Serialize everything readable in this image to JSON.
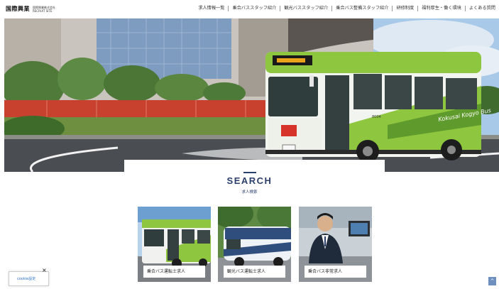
{
  "header": {
    "logo_mark": "国際興業",
    "logo_line1": "国際興業株式会社",
    "logo_line2": "RECRUIT SITE"
  },
  "nav": [
    "求人情報一覧",
    "乗合バススタッフ紹介",
    "観光バススタッフ紹介",
    "乗合バス整備スタッフ紹介",
    "研修制度",
    "福利厚生・働く環境",
    "よくある質問"
  ],
  "hero": {
    "bus_sign": "Kokusai Kogyo Bus",
    "bus_number": "8004"
  },
  "search": {
    "title": "SEARCH",
    "subtitle": "求人検索"
  },
  "cards": [
    {
      "label": "乗合バス運転士求人"
    },
    {
      "label": "観光バス運転士求人"
    },
    {
      "label": "乗合バス非常求人"
    }
  ],
  "cookie": {
    "link_text": "cookie設定",
    "close": "×"
  },
  "to_top": "^",
  "colors": {
    "brand_navy": "#2a3f6b",
    "bus_green": "#8ec63f",
    "bus_white": "#f2f4f0"
  }
}
